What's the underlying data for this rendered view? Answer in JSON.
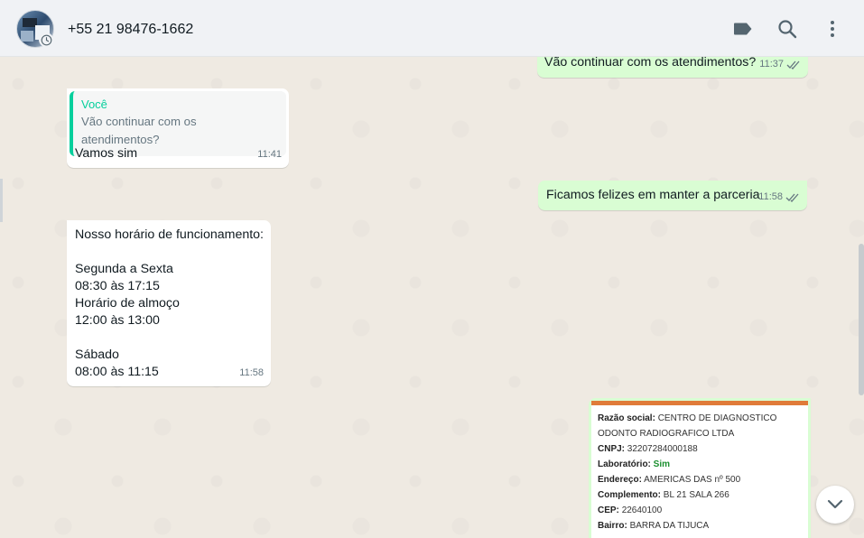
{
  "header": {
    "contact_name": "+55 21 98476-1662",
    "icons": [
      "label-icon",
      "search-icon",
      "menu-icon"
    ]
  },
  "messages": [
    {
      "id": "m1",
      "direction": "out",
      "text": "Vão continuar com os atendimentos?",
      "time": "11:37",
      "status": "read"
    },
    {
      "id": "m2",
      "direction": "in",
      "quoted_author": "Você",
      "quoted_text": "Vão continuar com os atendimentos?",
      "text": "Vamos sim",
      "time": "11:41"
    },
    {
      "id": "m3",
      "direction": "out",
      "text": "Ficamos felizes em manter a parceria",
      "time": "11:58",
      "status": "read"
    },
    {
      "id": "m4",
      "direction": "in",
      "text": "Nosso horário de funcionamento:\n\nSegunda a Sexta\n08:30 às 17:15\nHorário de almoço\n12:00 às 13:00\n\nSábado\n08:00 às 11:15",
      "time": "11:58"
    }
  ],
  "card": {
    "razao_label": "Razão social:",
    "razao_value": "CENTRO DE DIAGNOSTICO ODONTO RADIOGRAFICO LTDA",
    "cnpj_label": "CNPJ:",
    "cnpj_value": "32207284000188",
    "lab_label": "Laboratório:",
    "lab_value": "Sim",
    "endereco_label": "Endereço:",
    "endereco_value": "AMERICAS DAS nº 500",
    "complemento_label": "Complemento:",
    "complemento_value": "BL 21 SALA 266",
    "cep_label": "CEP:",
    "cep_value": "22640100",
    "bairro_label": "Bairro:",
    "bairro_value": "BARRA DA TIJUCA"
  },
  "colors": {
    "header_bg": "#f0f2f5",
    "chat_bg": "#efeae2",
    "bubble_out": "#d9fdd3",
    "bubble_in": "#ffffff",
    "quote_accent": "#06cf9c",
    "read_ticks": "#667781",
    "card_accent": "#e07b39"
  }
}
